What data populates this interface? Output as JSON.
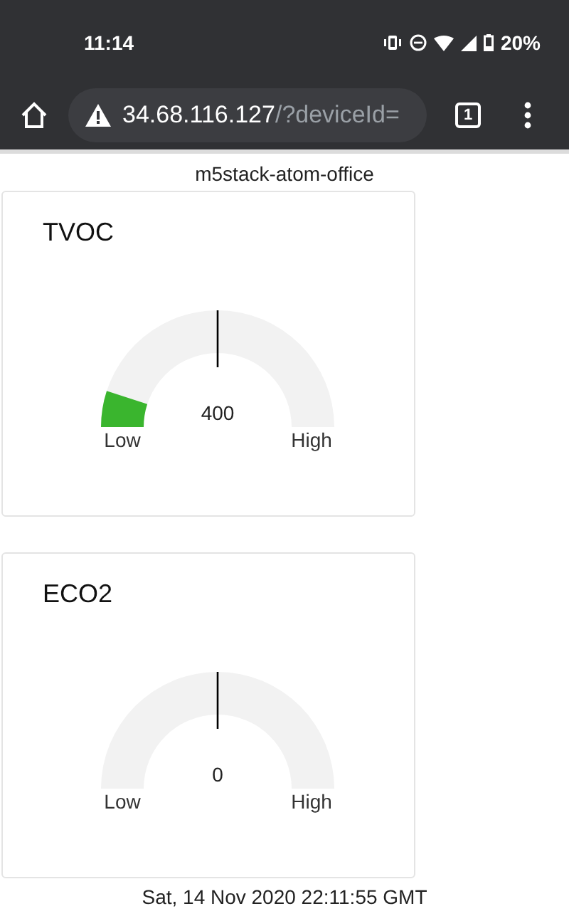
{
  "status_bar": {
    "time": "11:14",
    "battery": "20%"
  },
  "browser": {
    "url_host": "34.68.116.127",
    "url_path": "/?deviceId=",
    "tab_count": "1"
  },
  "device_name": "m5stack-atom-office",
  "gauges": [
    {
      "title": "TVOC",
      "value": "400",
      "low_label": "Low",
      "high_label": "High"
    },
    {
      "title": "ECO2",
      "value": "0",
      "low_label": "Low",
      "high_label": "High"
    }
  ],
  "timestamp": "Sat, 14 Nov 2020 22:11:55 GMT"
}
